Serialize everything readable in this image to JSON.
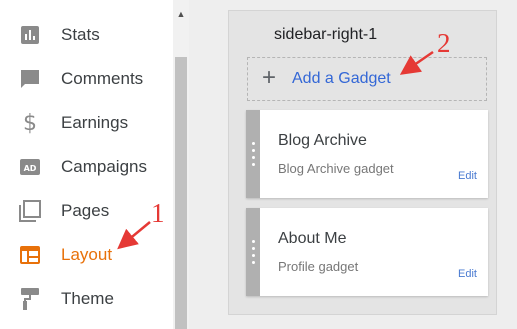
{
  "sidebar": {
    "items": [
      {
        "label": "Stats",
        "icon": "stats-icon",
        "active": false
      },
      {
        "label": "Comments",
        "icon": "comment-icon",
        "active": false
      },
      {
        "label": "Earnings",
        "icon": "dollar-icon",
        "active": false
      },
      {
        "label": "Campaigns",
        "icon": "ad-icon",
        "active": false
      },
      {
        "label": "Pages",
        "icon": "pages-icon",
        "active": false
      },
      {
        "label": "Layout",
        "icon": "layout-icon",
        "active": true
      },
      {
        "label": "Theme",
        "icon": "paint-roller-icon",
        "active": false
      }
    ]
  },
  "layout_panel": {
    "title": "sidebar-right-1",
    "add_gadget_label": "Add a Gadget",
    "gadgets": [
      {
        "title": "Blog Archive",
        "subtitle": "Blog Archive gadget",
        "edit_label": "Edit"
      },
      {
        "title": "About Me",
        "subtitle": "Profile gadget",
        "edit_label": "Edit"
      }
    ]
  },
  "annotations": {
    "marker_1": "1",
    "marker_2": "2"
  },
  "colors": {
    "active": "#e8710a",
    "link": "#3367d6",
    "annotation": "#e53935"
  }
}
